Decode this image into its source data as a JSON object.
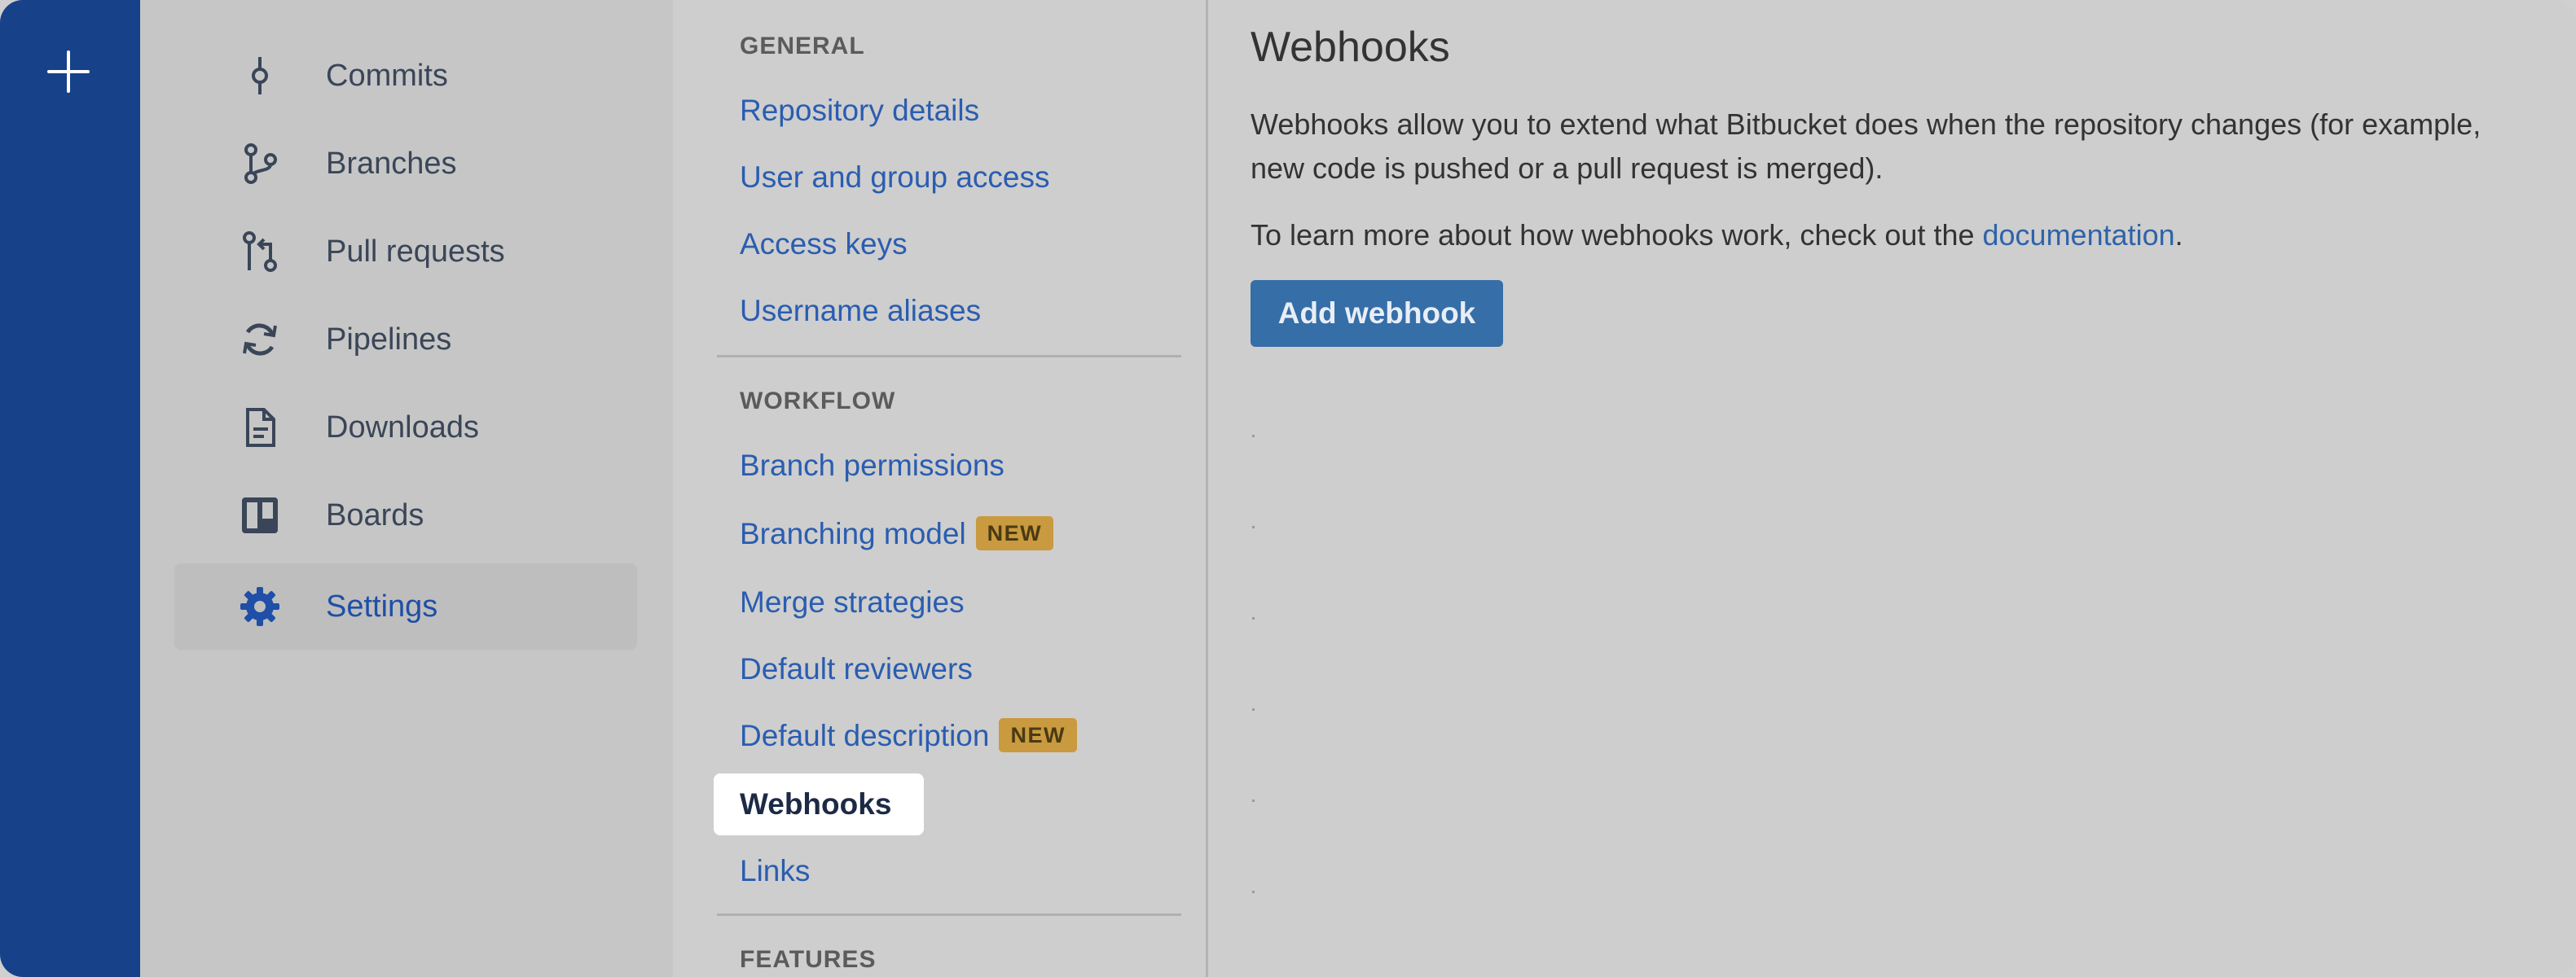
{
  "global_nav": {
    "create_icon": "plus-icon"
  },
  "repo_sidebar": {
    "items": [
      {
        "label": "Commits",
        "icon": "commit-icon",
        "active": false
      },
      {
        "label": "Branches",
        "icon": "branch-icon",
        "active": false
      },
      {
        "label": "Pull requests",
        "icon": "pull-request-icon",
        "active": false
      },
      {
        "label": "Pipelines",
        "icon": "pipelines-icon",
        "active": false
      },
      {
        "label": "Downloads",
        "icon": "downloads-icon",
        "active": false
      },
      {
        "label": "Boards",
        "icon": "boards-icon",
        "active": false
      },
      {
        "label": "Settings",
        "icon": "gear-icon",
        "active": true
      }
    ]
  },
  "settings_nav": {
    "general_heading": "GENERAL",
    "general_links": [
      "Repository details",
      "User and group access",
      "Access keys",
      "Username aliases"
    ],
    "workflow_heading": "WORKFLOW",
    "workflow_links": [
      {
        "label": "Branch permissions",
        "badge": ""
      },
      {
        "label": "Branching model",
        "badge": "NEW"
      },
      {
        "label": "Merge strategies",
        "badge": ""
      },
      {
        "label": "Default reviewers",
        "badge": ""
      },
      {
        "label": "Default description",
        "badge": "NEW"
      },
      {
        "label": "Webhooks",
        "badge": "",
        "active": true
      },
      {
        "label": "Links",
        "badge": ""
      }
    ],
    "features_heading": "FEATURES"
  },
  "main": {
    "title": "Webhooks",
    "description": "Webhooks allow you to extend what Bitbucket does when the repository changes (for example, new code is pushed or a pull request is merged).",
    "learn_more_prefix": "To learn more about how webhooks work, check out the ",
    "learn_more_link": "documentation",
    "learn_more_suffix": ".",
    "add_button": "Add webhook"
  },
  "colors": {
    "global_nav_bg": "#17428a",
    "link": "#2a5db0",
    "badge_bg": "#c99a3f",
    "primary_button": "#366ea8"
  }
}
